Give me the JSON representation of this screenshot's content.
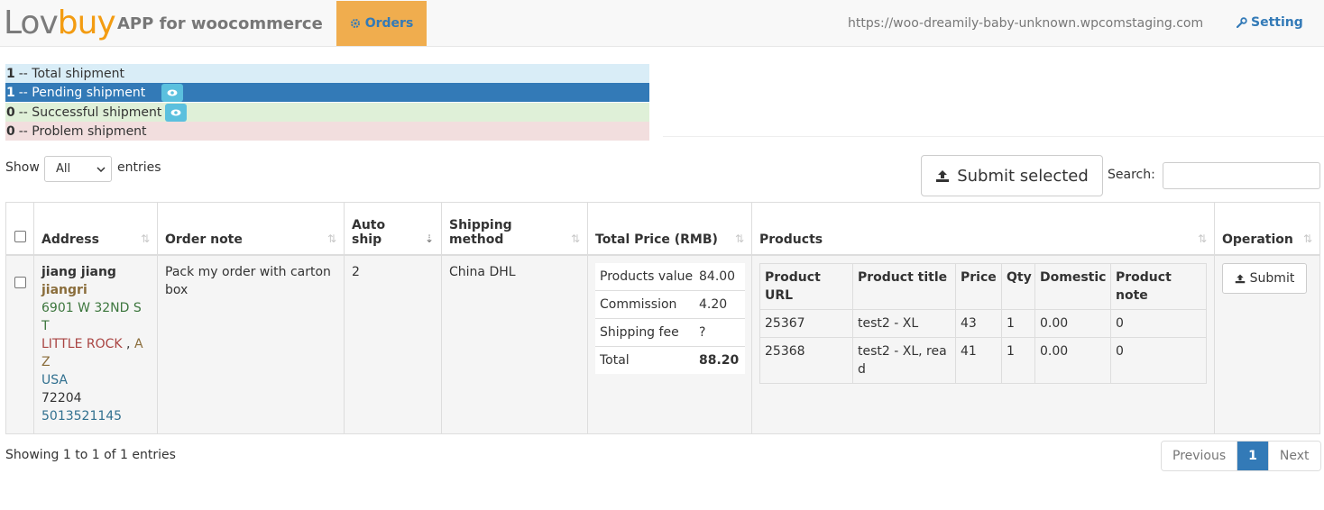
{
  "navbar": {
    "logo_part1": "Lov",
    "logo_part2": "buy",
    "app_title": "APP for woocommerce",
    "orders_tab": "Orders",
    "site_url": "https://woo-dreamily-baby-unknown.wpcomstaging.com",
    "setting": "Setting"
  },
  "status": [
    {
      "count": "1",
      "label": "-- Total shipment"
    },
    {
      "count": "1",
      "label": "-- Pending shipment"
    },
    {
      "count": "0",
      "label": "-- Successful shipment"
    },
    {
      "count": "0",
      "label": "-- Problem shipment"
    }
  ],
  "controls": {
    "show_label": "Show",
    "show_value": "All",
    "entries_label": "entries",
    "submit_selected": "Submit selected",
    "search_label": "Search:",
    "search_value": ""
  },
  "table": {
    "headers": {
      "address": "Address",
      "order_note": "Order note",
      "auto_ship": "Auto ship",
      "shipping_method": "Shipping method",
      "total_price": "Total Price (RMB)",
      "products": "Products",
      "operation": "Operation"
    },
    "row": {
      "address": {
        "name": "jiang jiang",
        "line2": "jiangri",
        "street": "6901 W 32ND ST",
        "city": "LITTLE ROCK",
        "state": "AZ",
        "country": "USA",
        "zip": "72204",
        "phone": "5013521145"
      },
      "order_note": "Pack my order with carton box",
      "auto_ship": "2",
      "shipping_method": "China DHL",
      "price": [
        {
          "label": "Products value",
          "value": "84.00"
        },
        {
          "label": "Commission",
          "value": "4.20"
        },
        {
          "label": "Shipping fee",
          "value": "?"
        },
        {
          "label": "Total",
          "value": "88.20"
        }
      ],
      "products": {
        "headers": [
          "Product URL",
          "Product title",
          "Price",
          "Qty",
          "Domestic",
          "Product note"
        ],
        "rows": [
          [
            "25367",
            "test2 - XL",
            "43",
            "1",
            "0.00",
            "0"
          ],
          [
            "25368",
            "test2 - XL, read",
            "41",
            "1",
            "0.00",
            "0"
          ]
        ]
      },
      "operation": "Submit"
    }
  },
  "footer": {
    "info": "Showing 1 to 1 of 1 entries",
    "previous": "Previous",
    "page": "1",
    "next": "Next"
  }
}
